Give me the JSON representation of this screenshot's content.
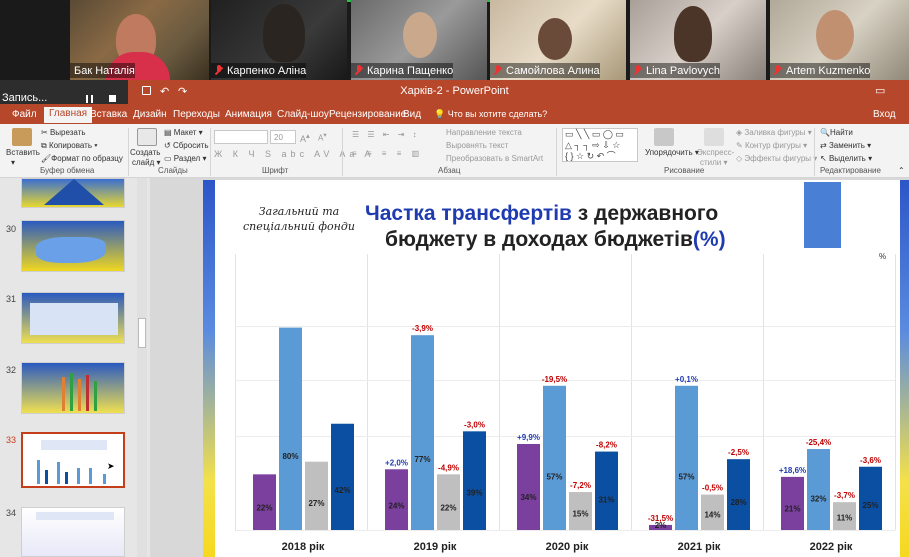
{
  "participants": [
    {
      "name": "Бак Наталія",
      "muted": false,
      "active": true
    },
    {
      "name": "Карпенко Аліна",
      "muted": true
    },
    {
      "name": "Карина Пащенко",
      "muted": true
    },
    {
      "name": "Самойлова Алина",
      "muted": true
    },
    {
      "name": "Lina Pavlovych",
      "muted": true
    },
    {
      "name": "Artem Kuzmenko",
      "muted": true
    }
  ],
  "recording": {
    "label": "Запись..."
  },
  "window": {
    "title": "Харків-2 - PowerPoint",
    "login": "Вход"
  },
  "tabs": [
    "Файл",
    "Главная",
    "Вставка",
    "Дизайн",
    "Переходы",
    "Анимация",
    "Слайд-шоу",
    "Рецензирование",
    "Вид",
    "Что вы хотите сделать?"
  ],
  "ribbon": {
    "paste": "Вставить",
    "cut": "Вырезать",
    "copy": "Копировать",
    "format_painter": "Формат по образцу",
    "clipboard": "Буфер обмена",
    "new_slide_1": "Создать",
    "new_slide_2": "слайд",
    "layout": "Макет",
    "reset": "Сбросить",
    "section": "Раздел",
    "slides": "Слайды",
    "font_size": "20",
    "font": "Шрифт",
    "text_direction": "Направление текста",
    "align_text": "Выровнять текст",
    "smartart": "Преобразовать в SmartArt",
    "paragraph": "Абзац",
    "arrange": "Упорядочить",
    "quick_styles_1": "Экспресс-",
    "quick_styles_2": "стили",
    "shape_fill": "Заливка фигуры",
    "shape_outline": "Контур фигуры",
    "shape_effects": "Эффекты фигуры",
    "drawing": "Рисование",
    "find": "Найти",
    "replace": "Заменить",
    "select": "Выделить",
    "editing": "Редактирование"
  },
  "slide_numbers": [
    "30",
    "31",
    "32",
    "33",
    "34"
  ],
  "slide": {
    "subtitle_1": "Загальний та",
    "subtitle_2": "спеціальний фонди",
    "title_hl": "Частка трансфертів",
    "title_rest": " з державного",
    "title_line2": "бюджету в доходах бюджетів",
    "title_pct": "(%)",
    "unit": "%"
  },
  "chart_data": {
    "type": "bar",
    "categories": [
      "2018 рік",
      "2019 рік",
      "2020 рік",
      "2021 рік",
      "2022 рік"
    ],
    "ylim": [
      0,
      100
    ],
    "series": [
      {
        "color": "#7b3f9e",
        "values": [
          22,
          24,
          34,
          2,
          21
        ],
        "changes": [
          "",
          "+2,0%",
          "+9,9%",
          "-31,5%",
          "+18,6%"
        ]
      },
      {
        "color": "#5b9bd5",
        "values": [
          80,
          77,
          57,
          57,
          32
        ],
        "changes": [
          "",
          "-3,9%",
          "-19,5%",
          "+0,1%",
          "-25,4%"
        ]
      },
      {
        "color": "#bfbfbf",
        "values": [
          27,
          22,
          15,
          14,
          11
        ],
        "changes": [
          "",
          "-4,9%",
          "-7,2%",
          "-0,5%",
          "-3,7%"
        ]
      },
      {
        "color": "#0b4fa2",
        "values": [
          42,
          39,
          31,
          28,
          25
        ],
        "changes": [
          "",
          "-3,0%",
          "-8,2%",
          "-2,5%",
          "-3,6%"
        ]
      }
    ]
  }
}
